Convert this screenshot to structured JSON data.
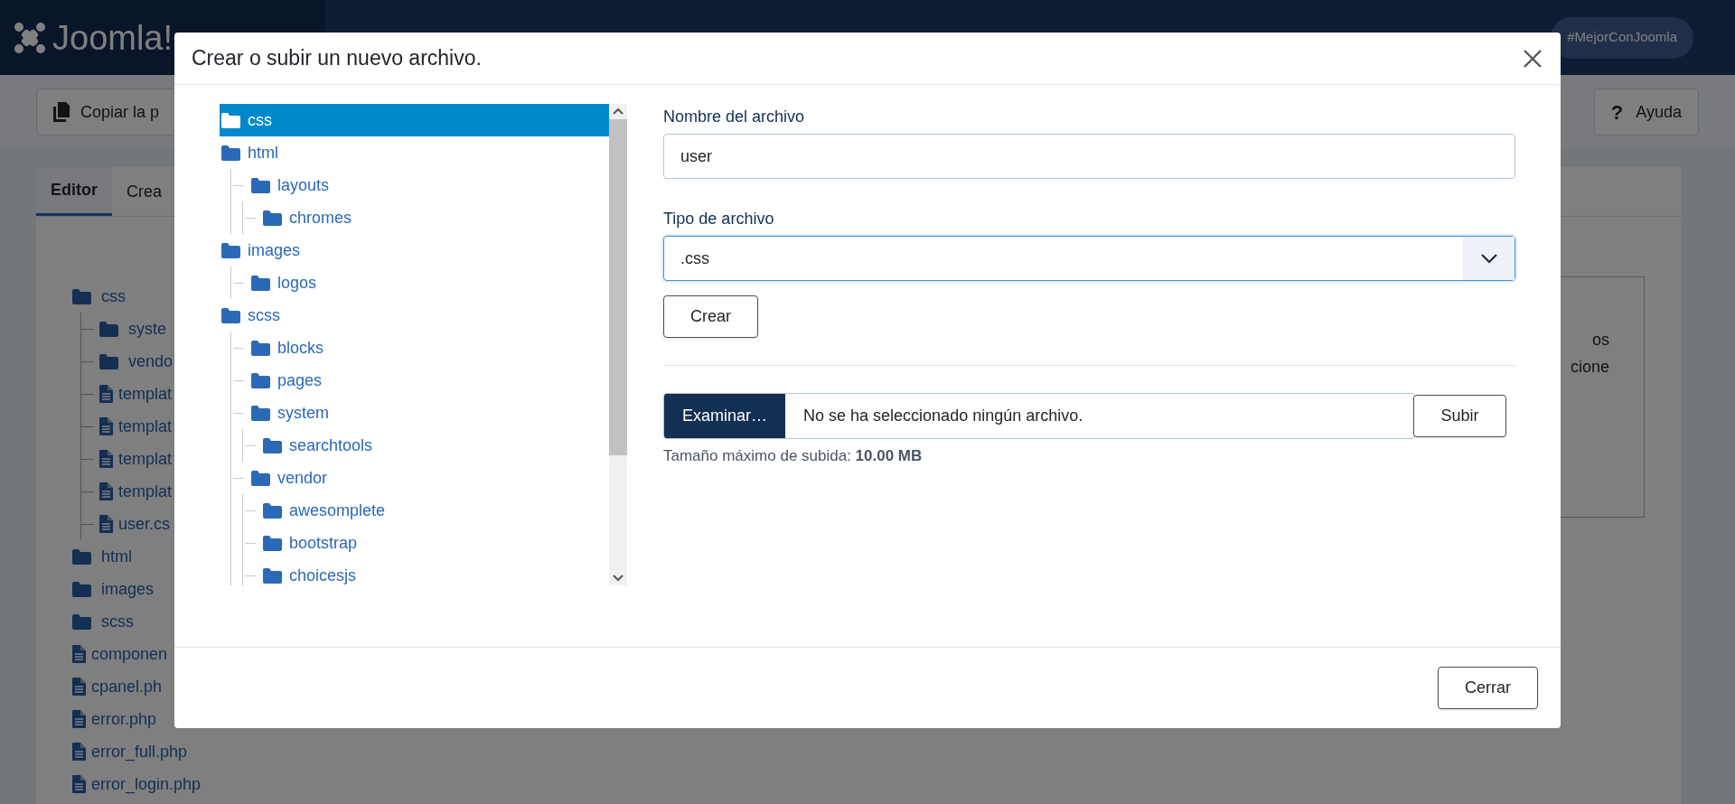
{
  "app": {
    "logo": "Joomla!",
    "promo_button": "#MejorConJoomla"
  },
  "toolbar": {
    "copy_button": "Copiar la p",
    "help_glyph": "?",
    "help_button": "Ayuda"
  },
  "tabs": [
    {
      "label": "Editor",
      "selected": true
    },
    {
      "label": "Crea",
      "selected": false
    }
  ],
  "file_tree": [
    {
      "kind": "folder",
      "label": "css",
      "children": [
        {
          "kind": "folder",
          "label": "syste"
        },
        {
          "kind": "folder",
          "label": "vendo"
        },
        {
          "kind": "file",
          "label": "templat"
        },
        {
          "kind": "file",
          "label": "templat"
        },
        {
          "kind": "file",
          "label": "templat"
        },
        {
          "kind": "file",
          "label": "templat"
        },
        {
          "kind": "file",
          "label": "user.cs"
        }
      ]
    },
    {
      "kind": "folder",
      "label": "html"
    },
    {
      "kind": "folder",
      "label": "images"
    },
    {
      "kind": "folder",
      "label": "scss"
    },
    {
      "kind": "file",
      "label": "componen"
    },
    {
      "kind": "file",
      "label": "cpanel.ph"
    },
    {
      "kind": "file",
      "label": "error.php"
    },
    {
      "kind": "file",
      "label": "error_full.php"
    },
    {
      "kind": "file",
      "label": "error_login.php"
    }
  ],
  "side_panel_fragments": [
    "os",
    "cione"
  ],
  "modal": {
    "title": "Crear o subir un nuevo archivo.",
    "folder_tree": [
      {
        "label": "css",
        "selected": true
      },
      {
        "label": "html",
        "selected": false,
        "children": [
          {
            "label": "layouts",
            "selected": false,
            "children": [
              {
                "label": "chromes",
                "selected": false
              }
            ]
          }
        ]
      },
      {
        "label": "images",
        "selected": false,
        "children": [
          {
            "label": "logos",
            "selected": false
          }
        ]
      },
      {
        "label": "scss",
        "selected": false,
        "children": [
          {
            "label": "blocks",
            "selected": false
          },
          {
            "label": "pages",
            "selected": false
          },
          {
            "label": "system",
            "selected": false,
            "children": [
              {
                "label": "searchtools",
                "selected": false
              }
            ]
          },
          {
            "label": "vendor",
            "selected": false,
            "children": [
              {
                "label": "awesomplete",
                "selected": false
              },
              {
                "label": "bootstrap",
                "selected": false
              },
              {
                "label": "choicesjs",
                "selected": false
              }
            ]
          }
        ]
      }
    ],
    "name_label": "Nombre del archivo",
    "name_value": "user",
    "type_label": "Tipo de archivo",
    "type_value": ".css",
    "create_button": "Crear",
    "browse_button": "Examinar…",
    "no_file_text": "No se ha seleccionado ningún archivo.",
    "upload_button": "Subir",
    "max_size": "Tamaño máximo de subida: **10.00 MB**",
    "close_button": "Cerrar"
  }
}
